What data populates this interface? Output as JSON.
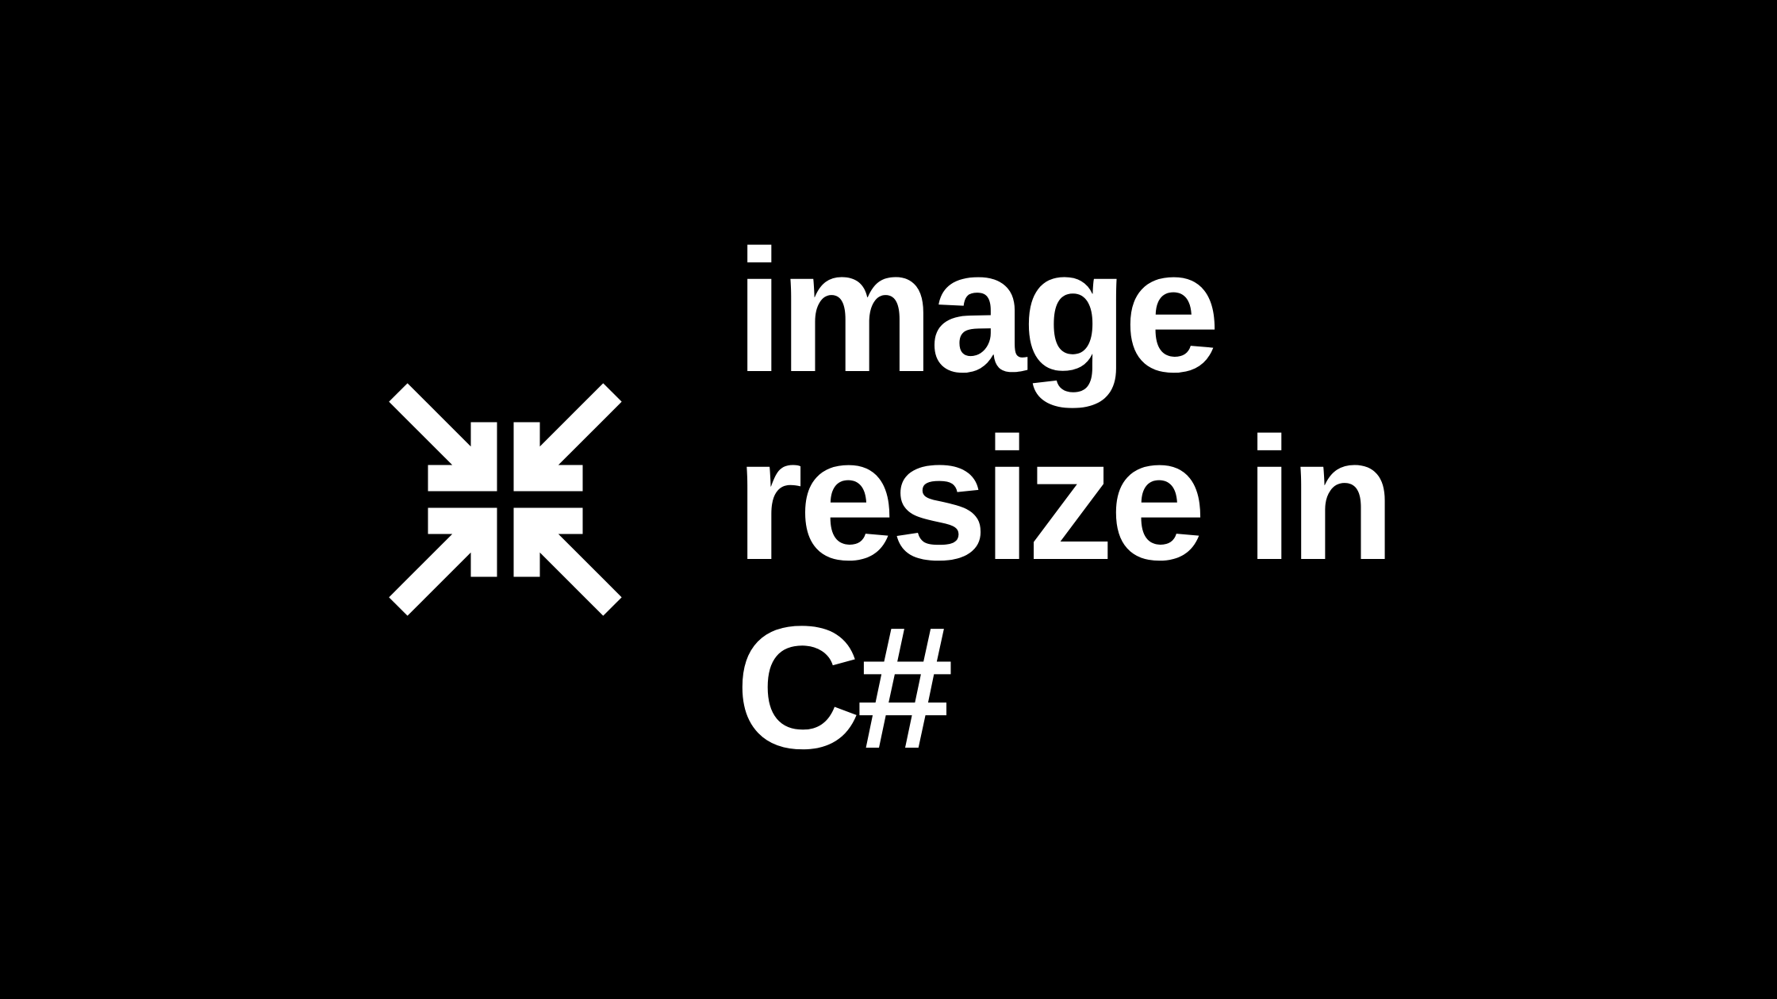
{
  "title": "image\nresize in\nC#",
  "icon_name": "collapse-arrows-icon",
  "colors": {
    "background": "#000000",
    "foreground": "#ffffff"
  }
}
